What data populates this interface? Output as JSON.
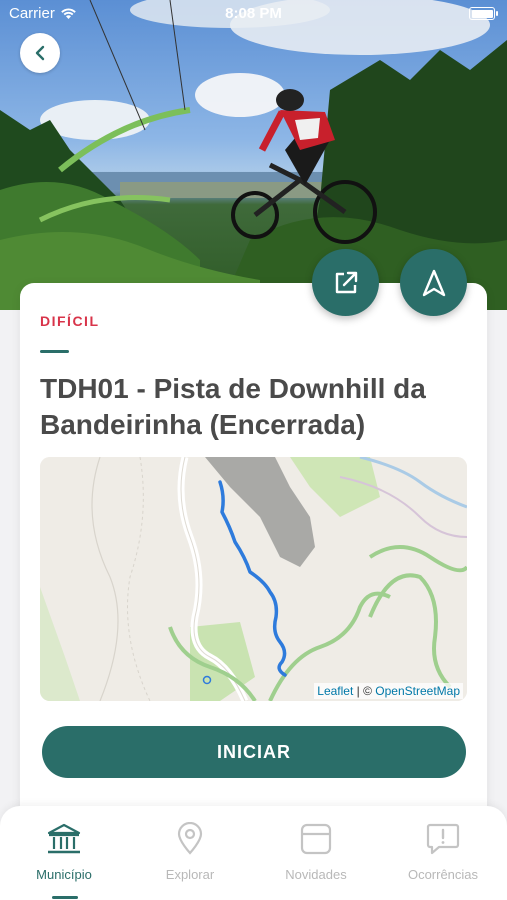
{
  "status_bar": {
    "carrier": "Carrier",
    "time": "8:08 PM"
  },
  "trail": {
    "difficulty": "DIFÍCIL",
    "title": "TDH01 - Pista de Downhill da Bandeirinha (Encerrada)"
  },
  "map": {
    "attribution_leaflet": "Leaflet",
    "attribution_sep": " | © ",
    "attribution_osm": "OpenStreetMap"
  },
  "actions": {
    "start_label": "INICIAR"
  },
  "icons": {
    "back": "chevron-left-icon",
    "share": "external-link-icon",
    "navigate": "navigation-arrow-icon"
  },
  "colors": {
    "primary": "#2a6e69",
    "difficulty": "#d8344a",
    "route": "#2e7bdc"
  },
  "tabs": [
    {
      "label": "Município",
      "icon": "town-hall-icon",
      "active": true
    },
    {
      "label": "Explorar",
      "icon": "map-pin-icon",
      "active": false
    },
    {
      "label": "Novidades",
      "icon": "news-card-icon",
      "active": false
    },
    {
      "label": "Ocorrências",
      "icon": "alert-message-icon",
      "active": false
    }
  ]
}
